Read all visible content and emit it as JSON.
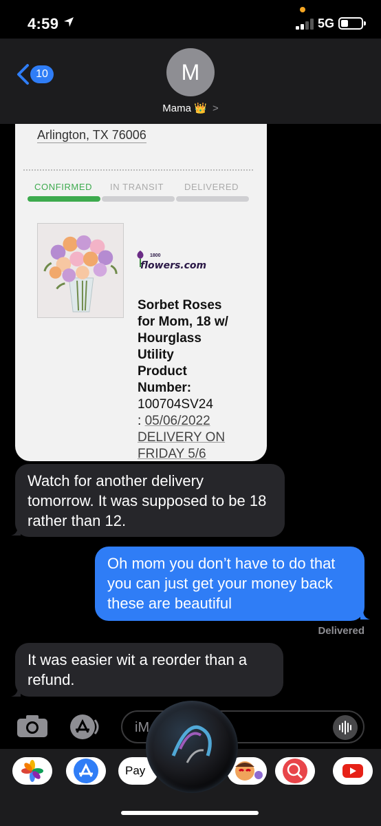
{
  "status_bar": {
    "time": "4:59",
    "network": "5G"
  },
  "header": {
    "back_count": "10",
    "avatar_initial": "M",
    "contact_name": "Mama",
    "crown_emoji": "👑",
    "chevron": ">"
  },
  "receipt": {
    "address": "Arlington, TX 76006",
    "steps": [
      "CONFIRMED",
      "IN TRANSIT",
      "DELIVERED"
    ],
    "brand_number": "1800",
    "brand_name": "flowers.com",
    "product_bold": [
      "Sorbet Roses",
      "for Mom, 18 w/",
      "Hourglass",
      "Utility",
      "Product",
      "Number:"
    ],
    "product_number": "100704SV24",
    "date_prefix": ": ",
    "date": "05/06/2022",
    "delivery_line1": "DELIVERY ON",
    "delivery_line2": "FRIDAY 5/6"
  },
  "messages": [
    {
      "direction": "incoming",
      "text": "Watch for another delivery tomorrow. It was supposed to be 18 rather than 12."
    },
    {
      "direction": "outgoing",
      "text": "Oh mom you don’t have to do that you can just get your money back these are beautiful"
    },
    {
      "direction": "incoming",
      "text": "It was easier wit a reorder than a refund."
    }
  ],
  "delivered_label": "Delivered",
  "compose": {
    "placeholder": "iM"
  },
  "apps": [
    "Photos",
    "App Store",
    "Apple Pay",
    "Memoji",
    "Search",
    "YouTube"
  ],
  "apple_pay_label": "Pay",
  "colors": {
    "blue": "#2F7DF6",
    "incoming": "#26262A",
    "confirmed": "#3DAA4E"
  }
}
